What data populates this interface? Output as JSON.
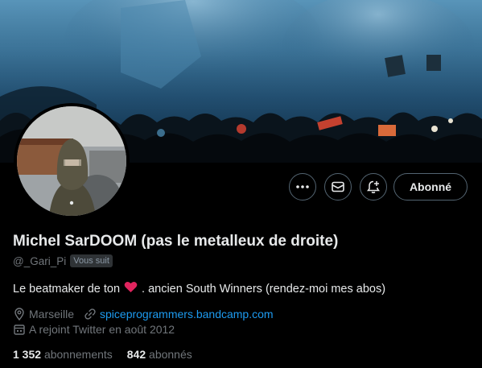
{
  "profile": {
    "display_name": "Michel SarDOOM (pas le metalleux de droite)",
    "handle": "@_Gari_Pi",
    "follows_you_badge": "Vous suit",
    "bio_before": "Le beatmaker de ton",
    "bio_emoji": "heart-emoji",
    "bio_after": ". ancien South Winners (rendez-moi mes abos)",
    "location": "Marseille",
    "website": "spiceprogrammers.bandcamp.com",
    "joined": "A rejoint Twitter en août 2012",
    "following_count": "1 352",
    "following_label": "abonnements",
    "followers_count": "842",
    "followers_label": "abonnés"
  },
  "actions": {
    "more_icon": "more-icon",
    "message_icon": "mail-icon",
    "notify_icon": "bell-plus-icon",
    "follow_label": "Abonné"
  },
  "colors": {
    "background": "#000000",
    "text": "#e7e9ea",
    "muted": "#71767b",
    "link": "#1d9bf0",
    "border": "#536471",
    "heart": "#f91880"
  }
}
